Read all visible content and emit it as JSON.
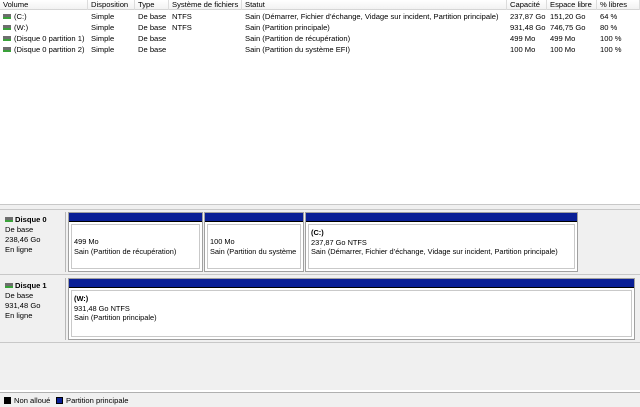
{
  "columns": {
    "volume": "Volume",
    "layout": "Disposition",
    "type": "Type",
    "filesystem": "Système de fichiers",
    "status": "Statut",
    "capacity": "Capacité",
    "free": "Espace libre",
    "pct_free": "% libres"
  },
  "volumes": [
    {
      "name": "(C:)",
      "layout": "Simple",
      "type": "De base",
      "fs": "NTFS",
      "status": "Sain (Démarrer, Fichier d’échange, Vidage sur incident, Partition principale)",
      "capacity": "237,87 Go",
      "free": "151,20 Go",
      "pct": "64 %"
    },
    {
      "name": "(W:)",
      "layout": "Simple",
      "type": "De base",
      "fs": "NTFS",
      "status": "Sain (Partition principale)",
      "capacity": "931,48 Go",
      "free": "746,75 Go",
      "pct": "80 %"
    },
    {
      "name": "(Disque 0 partition 1)",
      "layout": "Simple",
      "type": "De base",
      "fs": "",
      "status": "Sain (Partition de récupération)",
      "capacity": "499 Mo",
      "free": "499 Mo",
      "pct": "100 %"
    },
    {
      "name": "(Disque 0 partition 2)",
      "layout": "Simple",
      "type": "De base",
      "fs": "",
      "status": "Sain (Partition du système EFI)",
      "capacity": "100 Mo",
      "free": "100 Mo",
      "pct": "100 %"
    }
  ],
  "disks": [
    {
      "name": "Disque 0",
      "type": "De base",
      "size": "238,46 Go",
      "state": "En ligne",
      "partitions": [
        {
          "label": "",
          "size": "499 Mo",
          "status": "Sain (Partition de récupération)"
        },
        {
          "label": "",
          "size": "100 Mo",
          "status": "Sain (Partition du système"
        },
        {
          "label": "(C:)",
          "size": "237,87 Go NTFS",
          "status": "Sain (Démarrer, Fichier d’échange, Vidage sur incident, Partition principale)"
        }
      ]
    },
    {
      "name": "Disque 1",
      "type": "De base",
      "size": "931,48 Go",
      "state": "En ligne",
      "partitions": [
        {
          "label": "(W:)",
          "size": "931,48 Go NTFS",
          "status": "Sain (Partition principale)"
        }
      ]
    }
  ],
  "legend": [
    {
      "label": "Non alloué",
      "color": "#000000"
    },
    {
      "label": "Partition principale",
      "color": "#0a1f96"
    }
  ],
  "colors": {
    "partition_bar": "#0a1f96",
    "healthy_accent": "#3aa13a"
  }
}
